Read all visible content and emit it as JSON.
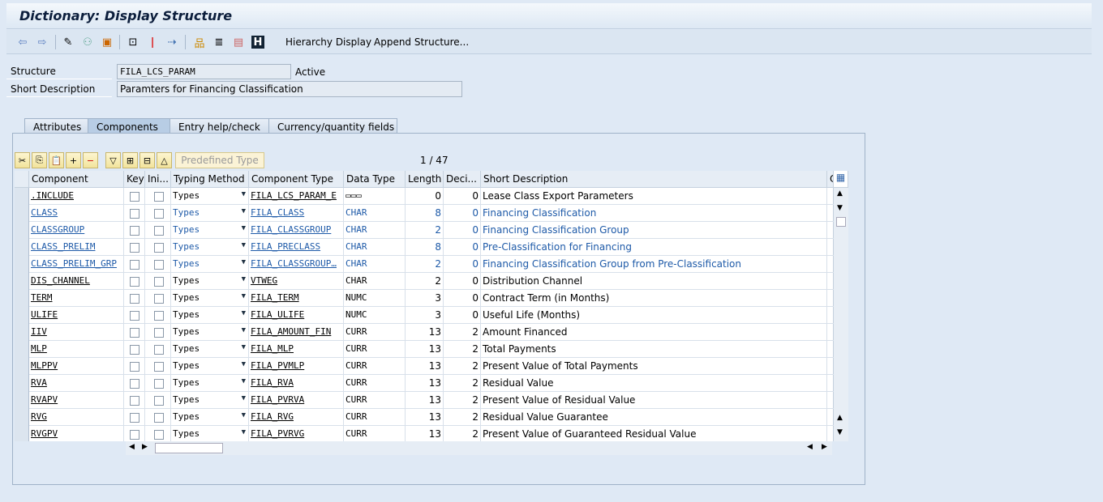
{
  "window": {
    "title": "Dictionary: Display Structure"
  },
  "toolbar": {
    "hierarchy_display": "Hierarchy Display",
    "append_structure": "Append Structure...",
    "icons": [
      "back-arrow-icon",
      "forward-arrow-icon",
      "edit-pencil-icon",
      "check-icon",
      "activate-icon",
      "where-used-icon",
      "magic-wand-icon",
      "navigate-icon",
      "hierarchy-icon",
      "stack-icon",
      "display-icon",
      "info-icon"
    ]
  },
  "header": {
    "structure_label": "Structure",
    "structure_value": "FILA_LCS_PARAM",
    "status": "Active",
    "desc_label": "Short Description",
    "desc_value": "Paramters for Financing Classification"
  },
  "tabs": [
    {
      "label": "Attributes"
    },
    {
      "label": "Components",
      "active": true
    },
    {
      "label": "Entry help/check"
    },
    {
      "label": "Currency/quantity fields"
    }
  ],
  "grid_toolbar": {
    "predefined_type": "Predefined Type",
    "pager": "1 / 47"
  },
  "columns": [
    "Component",
    "Key",
    "Ini...",
    "Typing Method",
    "Component Type",
    "Data Type",
    "Length",
    "Deci...",
    "Short Description",
    "C"
  ],
  "rows": [
    {
      "component": ".INCLUDE",
      "method": "Types",
      "ctype": "FILA_LCS_PARAM_E",
      "dtype": "▭▭▭",
      "length": "0",
      "dec": "0",
      "desc": "Lease Class Export Parameters",
      "blue": false
    },
    {
      "component": "CLASS",
      "method": "Types",
      "ctype": "FILA_CLASS",
      "dtype": "CHAR",
      "length": "8",
      "dec": "0",
      "desc": "Financing Classification",
      "blue": true
    },
    {
      "component": "CLASSGROUP",
      "method": "Types",
      "ctype": "FILA_CLASSGROUP",
      "dtype": "CHAR",
      "length": "2",
      "dec": "0",
      "desc": "Financing Classification Group",
      "blue": true
    },
    {
      "component": "CLASS_PRELIM",
      "method": "Types",
      "ctype": "FILA_PRECLASS",
      "dtype": "CHAR",
      "length": "8",
      "dec": "0",
      "desc": "Pre-Classification for Financing",
      "blue": true
    },
    {
      "component": "CLASS_PRELIM_GRP",
      "method": "Types",
      "ctype": "FILA_CLASSGROUP…",
      "dtype": "CHAR",
      "length": "2",
      "dec": "0",
      "desc": "Financing Classification Group from Pre-Classification",
      "blue": true
    },
    {
      "component": "DIS_CHANNEL",
      "method": "Types",
      "ctype": "VTWEG",
      "dtype": "CHAR",
      "length": "2",
      "dec": "0",
      "desc": "Distribution Channel",
      "blue": false
    },
    {
      "component": "TERM",
      "method": "Types",
      "ctype": "FILA_TERM",
      "dtype": "NUMC",
      "length": "3",
      "dec": "0",
      "desc": "Contract Term (in Months)",
      "blue": false
    },
    {
      "component": "ULIFE",
      "method": "Types",
      "ctype": "FILA_ULIFE",
      "dtype": "NUMC",
      "length": "3",
      "dec": "0",
      "desc": "Useful Life (Months)",
      "blue": false
    },
    {
      "component": "IIV",
      "method": "Types",
      "ctype": "FILA_AMOUNT_FIN",
      "dtype": "CURR",
      "length": "13",
      "dec": "2",
      "desc": "Amount Financed",
      "blue": false
    },
    {
      "component": "MLP",
      "method": "Types",
      "ctype": "FILA_MLP",
      "dtype": "CURR",
      "length": "13",
      "dec": "2",
      "desc": "Total Payments",
      "blue": false
    },
    {
      "component": "MLPPV",
      "method": "Types",
      "ctype": "FILA_PVMLP",
      "dtype": "CURR",
      "length": "13",
      "dec": "2",
      "desc": "Present Value of Total Payments",
      "blue": false
    },
    {
      "component": "RVA",
      "method": "Types",
      "ctype": "FILA_RVA",
      "dtype": "CURR",
      "length": "13",
      "dec": "2",
      "desc": "Residual Value",
      "blue": false
    },
    {
      "component": "RVAPV",
      "method": "Types",
      "ctype": "FILA_PVRVA",
      "dtype": "CURR",
      "length": "13",
      "dec": "2",
      "desc": "Present Value of Residual Value",
      "blue": false
    },
    {
      "component": "RVG",
      "method": "Types",
      "ctype": "FILA_RVG",
      "dtype": "CURR",
      "length": "13",
      "dec": "2",
      "desc": "Residual Value Guarantee",
      "blue": false
    },
    {
      "component": "RVGPV",
      "method": "Types",
      "ctype": "FILA_PVRVG",
      "dtype": "CURR",
      "length": "13",
      "dec": "2",
      "desc": "Present Value of Guaranteed Residual Value",
      "blue": false
    }
  ]
}
